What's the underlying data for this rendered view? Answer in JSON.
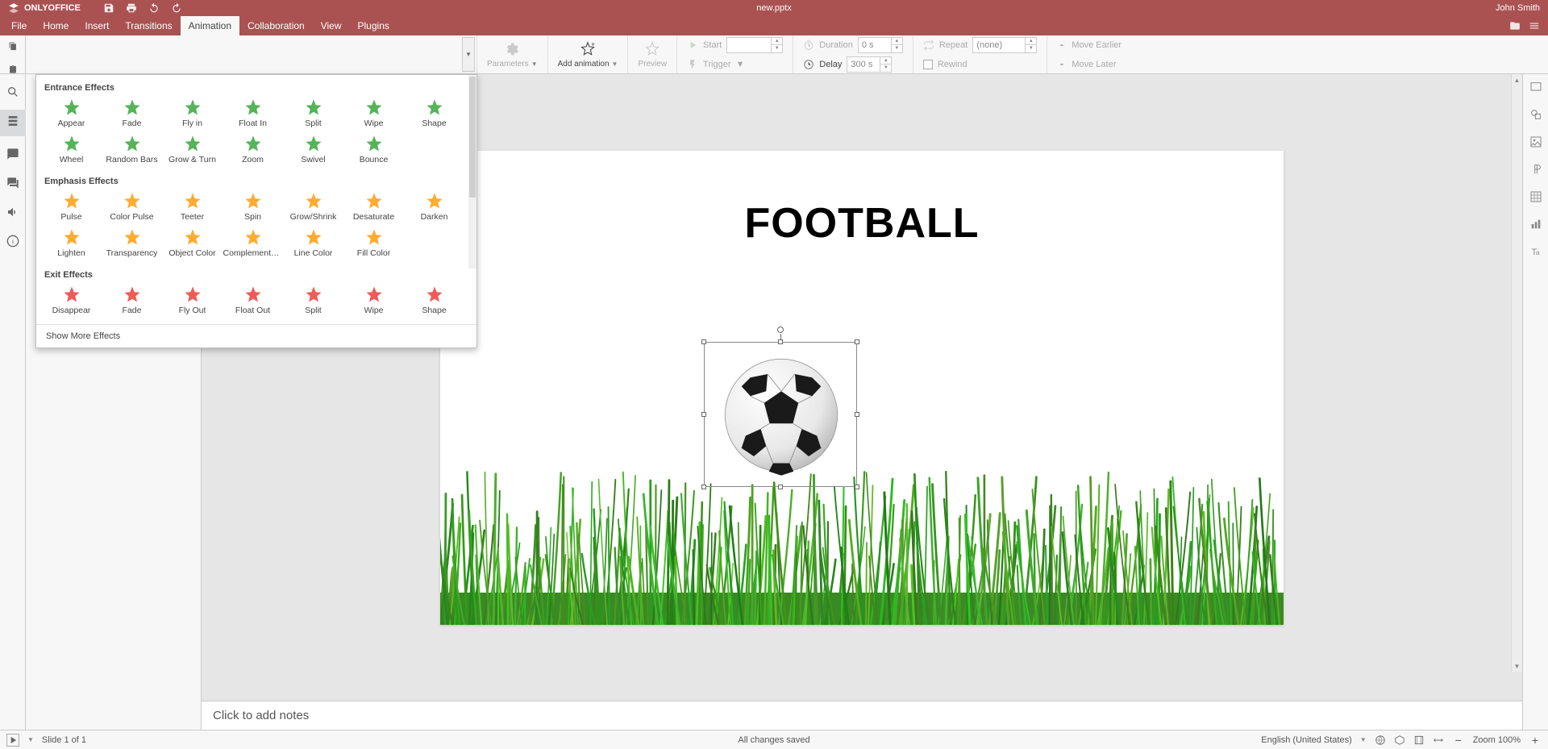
{
  "app": {
    "name": "ONLYOFFICE",
    "document": "new.pptx",
    "user": "John Smith"
  },
  "menu": {
    "tabs": [
      "File",
      "Home",
      "Insert",
      "Transitions",
      "Animation",
      "Collaboration",
      "View",
      "Plugins"
    ],
    "active_index": 4
  },
  "toolbar": {
    "parameters": "Parameters",
    "add_animation": "Add animation",
    "preview": "Preview",
    "start": "Start",
    "trigger": "Trigger",
    "duration": "Duration",
    "duration_value": "0 s",
    "delay": "Delay",
    "delay_value": "300 s",
    "repeat": "Repeat",
    "repeat_value": "(none)",
    "rewind": "Rewind",
    "move_earlier": "Move Earlier",
    "move_later": "Move Later"
  },
  "effects_popup": {
    "entrance_title": "Entrance Effects",
    "emphasis_title": "Emphasis Effects",
    "exit_title": "Exit Effects",
    "show_more": "Show More Effects",
    "entrance": [
      "Appear",
      "Fade",
      "Fly in",
      "Float In",
      "Split",
      "Wipe",
      "Shape",
      "Wheel",
      "Random Bars",
      "Grow & Turn",
      "Zoom",
      "Swivel",
      "Bounce"
    ],
    "emphasis": [
      "Pulse",
      "Color Pulse",
      "Teeter",
      "Spin",
      "Grow/Shrink",
      "Desaturate",
      "Darken",
      "Lighten",
      "Transparency",
      "Object Color",
      "Complementar...",
      "Line Color",
      "Fill Color"
    ],
    "exit": [
      "Disappear",
      "Fade",
      "Fly Out",
      "Float Out",
      "Split",
      "Wipe",
      "Shape"
    ]
  },
  "slide": {
    "title_text": "FOOTBALL"
  },
  "notes": {
    "placeholder": "Click to add notes"
  },
  "status": {
    "slide_info": "Slide 1 of 1",
    "save_state": "All changes saved",
    "language": "English (United States)",
    "zoom": "Zoom 100%"
  },
  "colors": {
    "entrance": "#4caf50",
    "emphasis": "#ffa726",
    "exit": "#ef5350"
  }
}
